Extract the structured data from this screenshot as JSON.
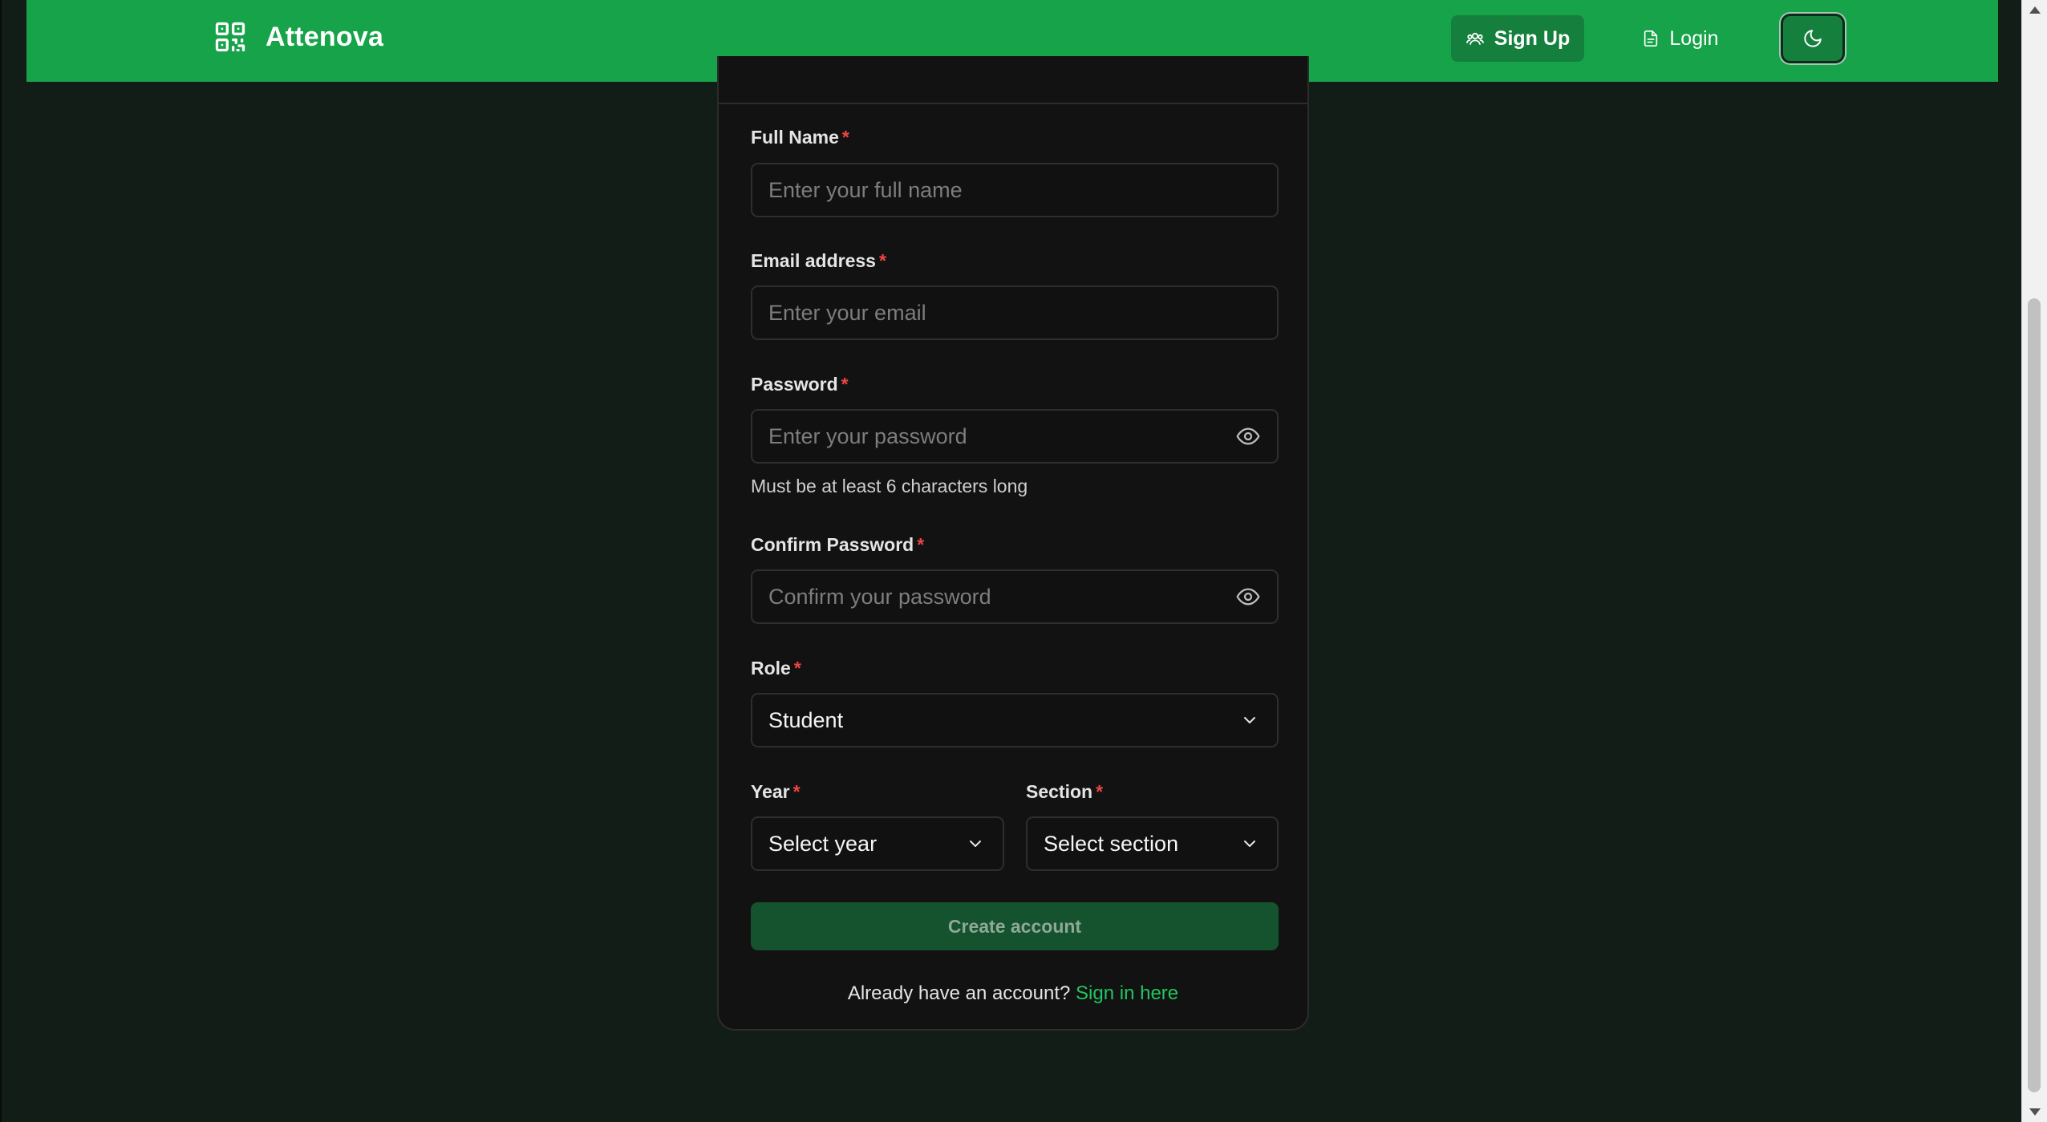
{
  "header": {
    "brand_name": "Attenova",
    "signup_label": "Sign Up",
    "login_label": "Login"
  },
  "form": {
    "full_name": {
      "label": "Full Name",
      "placeholder": "Enter your full name"
    },
    "email": {
      "label": "Email address",
      "placeholder": "Enter your email"
    },
    "password": {
      "label": "Password",
      "placeholder": "Enter your password",
      "hint": "Must be at least 6 characters long"
    },
    "confirm_password": {
      "label": "Confirm Password",
      "placeholder": "Confirm your password"
    },
    "role": {
      "label": "Role",
      "value": "Student"
    },
    "year": {
      "label": "Year",
      "value": "Select year"
    },
    "section": {
      "label": "Section",
      "value": "Select section"
    },
    "required_mark": "*",
    "submit_label": "Create account",
    "footer_prompt": "Already have an account?",
    "footer_link": "Sign in here"
  },
  "colors": {
    "brand_green": "#16a34a",
    "button_green_dark": "#15803d",
    "disabled_submit": "#14532d",
    "link_green": "#22c55e",
    "required_red": "#ef4444",
    "page_bg": "#131d18",
    "card_bg": "#121212"
  },
  "icons": {
    "brand": "qr-code-icon",
    "signup": "users-icon",
    "login": "file-icon",
    "theme": "moon-icon",
    "password_toggle": "eye-icon",
    "select": "chevron-down-icon"
  }
}
